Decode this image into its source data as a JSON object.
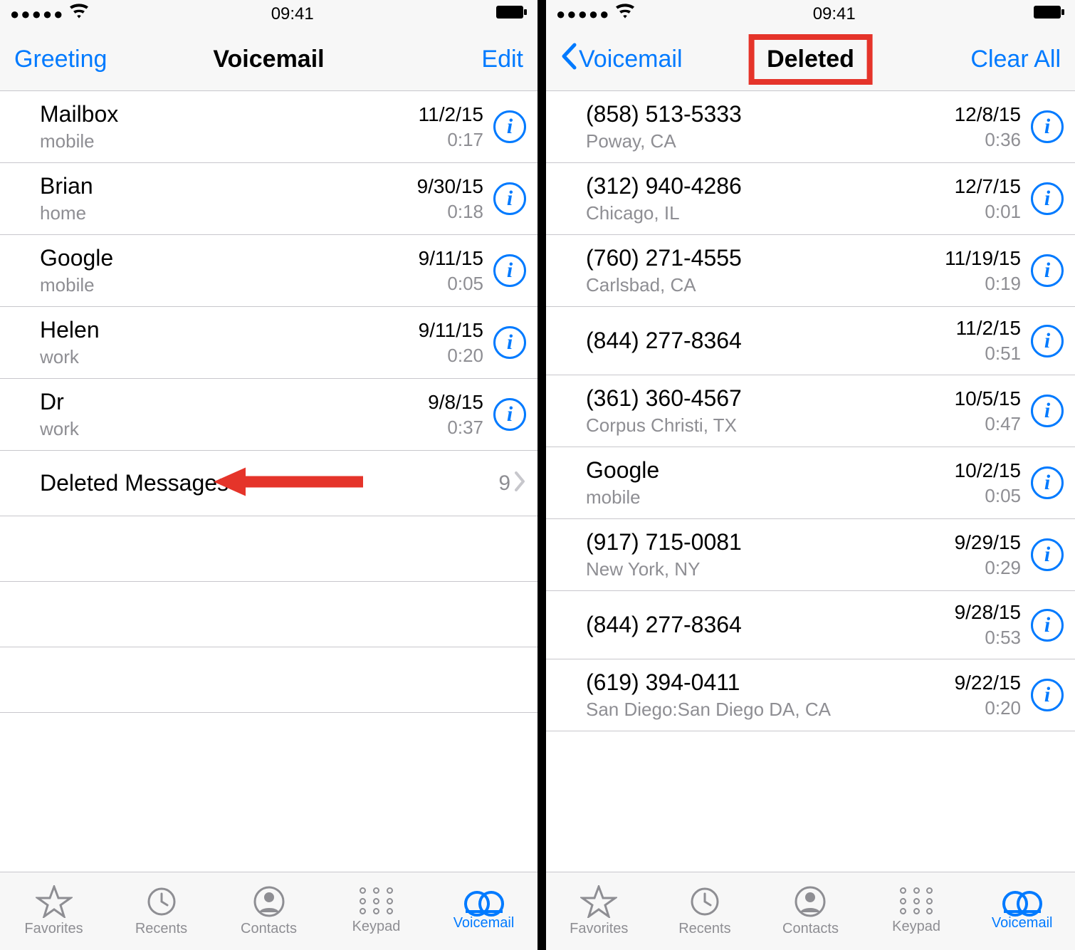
{
  "status": {
    "time": "09:41"
  },
  "left": {
    "nav": {
      "left": "Greeting",
      "title": "Voicemail",
      "right": "Edit"
    },
    "items": [
      {
        "name": "Mailbox",
        "sub": "mobile",
        "date": "11/2/15",
        "dur": "0:17"
      },
      {
        "name": "Brian",
        "sub": "home",
        "date": "9/30/15",
        "dur": "0:18"
      },
      {
        "name": "Google",
        "sub": "mobile",
        "date": "9/11/15",
        "dur": "0:05"
      },
      {
        "name": "Helen",
        "sub": "work",
        "date": "9/11/15",
        "dur": "0:20"
      },
      {
        "name": "Dr",
        "sub": "work",
        "date": "9/8/15",
        "dur": "0:37"
      }
    ],
    "deleted": {
      "label": "Deleted Messages",
      "count": "9"
    }
  },
  "right": {
    "nav": {
      "back": "Voicemail",
      "title": "Deleted",
      "right": "Clear All"
    },
    "items": [
      {
        "name": "(858) 513-5333",
        "sub": "Poway, CA",
        "date": "12/8/15",
        "dur": "0:36"
      },
      {
        "name": "(312) 940-4286",
        "sub": "Chicago, IL",
        "date": "12/7/15",
        "dur": "0:01"
      },
      {
        "name": "(760) 271-4555",
        "sub": "Carlsbad, CA",
        "date": "11/19/15",
        "dur": "0:19"
      },
      {
        "name": "(844) 277-8364",
        "sub": "",
        "date": "11/2/15",
        "dur": "0:51"
      },
      {
        "name": "(361) 360-4567",
        "sub": "Corpus Christi, TX",
        "date": "10/5/15",
        "dur": "0:47"
      },
      {
        "name": "Google",
        "sub": "mobile",
        "date": "10/2/15",
        "dur": "0:05"
      },
      {
        "name": "(917) 715-0081",
        "sub": "New York, NY",
        "date": "9/29/15",
        "dur": "0:29"
      },
      {
        "name": "(844) 277-8364",
        "sub": "",
        "date": "9/28/15",
        "dur": "0:53"
      },
      {
        "name": "(619) 394-0411",
        "sub": "San Diego:San Diego DA, CA",
        "date": "9/22/15",
        "dur": "0:20"
      }
    ]
  },
  "tabs": {
    "favorites": "Favorites",
    "recents": "Recents",
    "contacts": "Contacts",
    "keypad": "Keypad",
    "voicemail": "Voicemail"
  }
}
